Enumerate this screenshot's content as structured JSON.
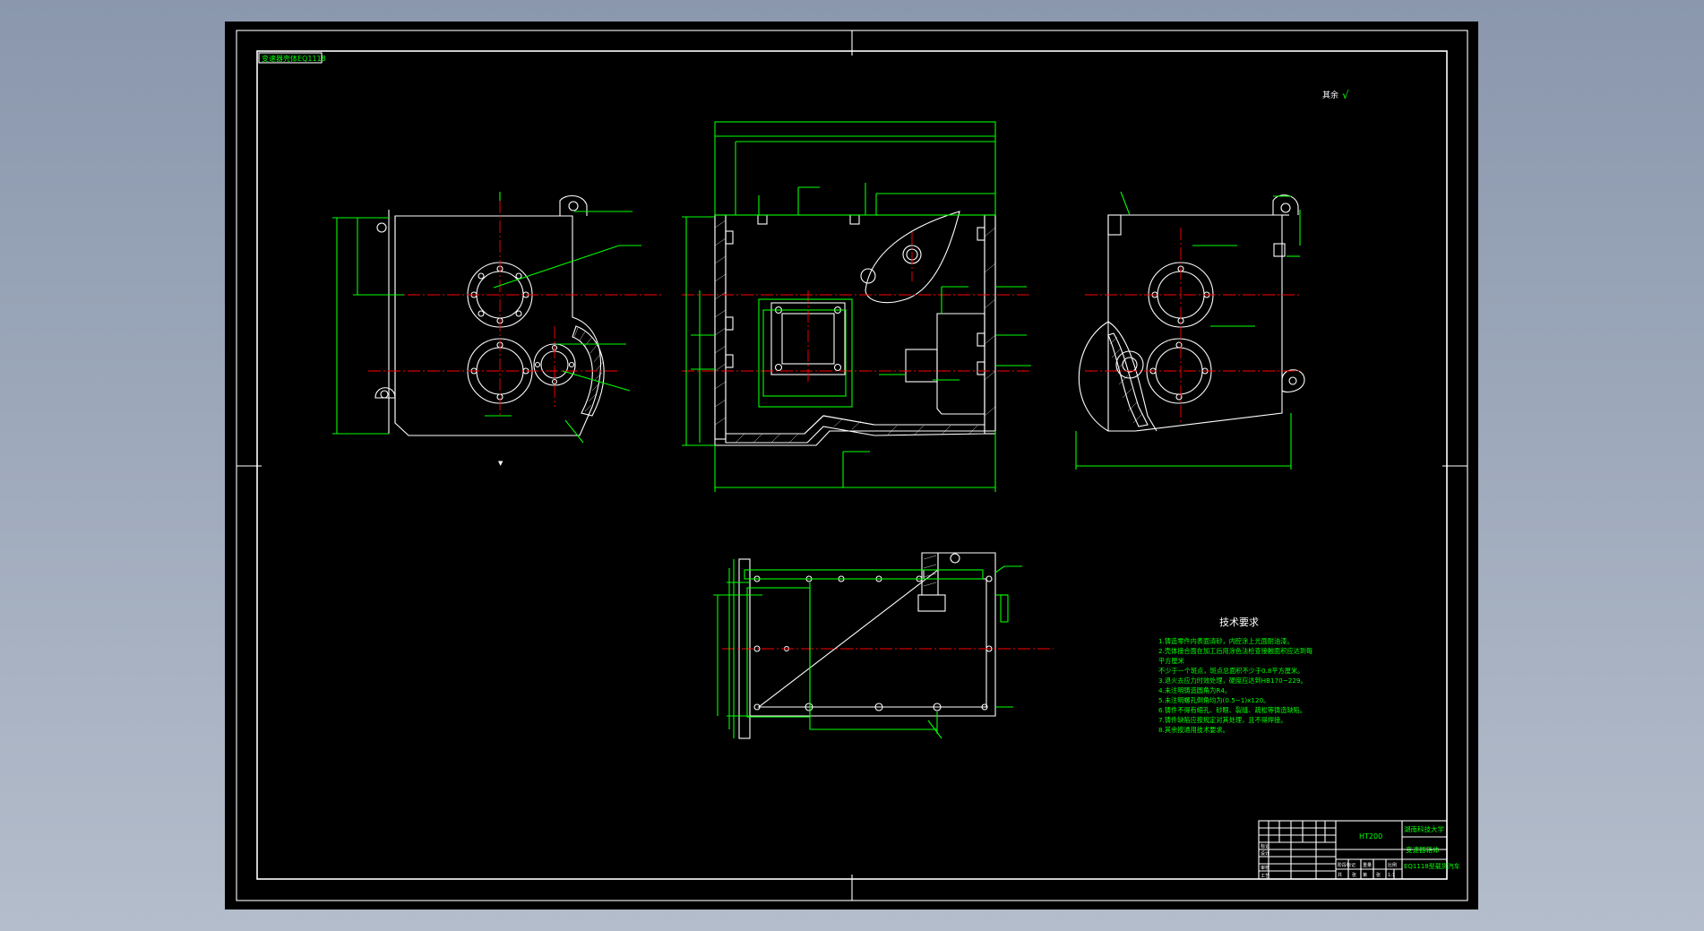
{
  "drawing": {
    "title_tag": "变速器壳体EQ1118",
    "roughness_note": "其余",
    "roughness_symbol": "√",
    "tech_requirements": {
      "heading": "技术要求",
      "items": [
        "1.铸造零件内表面清砂，内腔涂上光面耐油漆。",
        "2.壳体接合面在加工后用涂色法检查接触面积应达到每",
        "平方厘米",
        "不少于一个斑点，斑点总面积不少于0.8平方厘米。",
        "3.退火去应力时效处理，硬度应达到HB170~229。",
        "4.未注明铸造圆角为R4。",
        "5.未注明螺孔倒角均为(0.5~1)x120。",
        "6.铸件不得有缩孔、砂眼、裂缝、疏松等铸造缺陷。",
        "7.铸件缺陷应按规定对其处理，且不得焊接。",
        "8.其余按通用技术要求。"
      ]
    },
    "title_block": {
      "material": "HT200",
      "school": "湖南科技大学",
      "part_name": "变速器箱体",
      "product_name": "EQ1118型载货汽车",
      "row_labels": [
        "标记",
        "设计",
        "审核",
        "工艺"
      ],
      "stage_labels": [
        "阶段标记",
        "重量",
        "比例"
      ],
      "scale": "1:1",
      "sheet_labels": [
        "共",
        "张",
        "第",
        "张"
      ]
    }
  }
}
